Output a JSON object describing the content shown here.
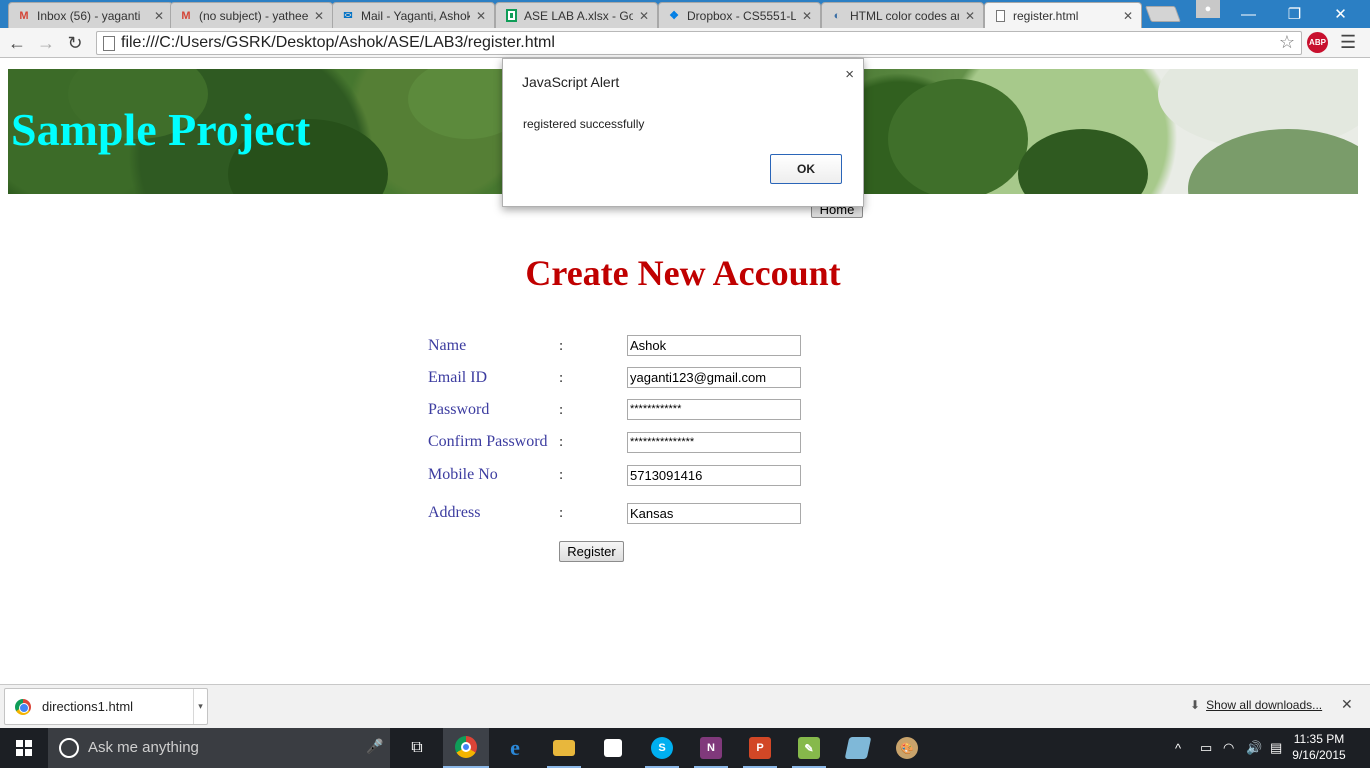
{
  "browser": {
    "tabs": [
      {
        "title": "Inbox (56) - yaganti",
        "icon": "gmail-icon",
        "icon_color": "#d44638"
      },
      {
        "title": "(no subject) - yathee",
        "icon": "gmail-icon",
        "icon_color": "#d44638"
      },
      {
        "title": "Mail - Yaganti, Ashok",
        "icon": "mail-icon",
        "icon_color": "#0072c6"
      },
      {
        "title": "ASE LAB A.xlsx - Goo",
        "icon": "sheets-icon",
        "icon_color": "#0f9d58"
      },
      {
        "title": "Dropbox - CS5551-L",
        "icon": "dropbox-icon",
        "icon_color": "#007ee5"
      },
      {
        "title": "HTML color codes an",
        "icon": "colorcodes-icon",
        "icon_color": "#3a6ea5"
      },
      {
        "title": "register.html",
        "icon": "page-icon",
        "icon_color": "#777777",
        "active": true
      }
    ],
    "url": "file:///C:/Users/GSRK/Desktop/Ashok/ASE/LAB3/register.html",
    "abp_label": "ABP"
  },
  "page": {
    "banner_title": "Sample Project",
    "home_button": "Home",
    "heading": "Create New Account",
    "colon": ":",
    "fields": [
      {
        "label": "Name",
        "value": "Ashok"
      },
      {
        "label": "Email ID",
        "value": "yaganti123@gmail.com"
      },
      {
        "label": "Password",
        "value": "************"
      },
      {
        "label": "Confirm Password",
        "value": "***************"
      },
      {
        "label": "Mobile No",
        "value": "5713091416"
      },
      {
        "label": "Address",
        "value": "Kansas"
      }
    ],
    "register_button": "Register",
    "colors": {
      "banner_title": "#00ffff",
      "heading": "#c00000",
      "labels": "#3c3ca0"
    }
  },
  "alert": {
    "title": "JavaScript Alert",
    "message": "registered successfully",
    "ok_label": "OK",
    "close_glyph": "×"
  },
  "downloads": {
    "item": "directions1.html",
    "show_all": "Show all downloads..."
  },
  "taskbar": {
    "search_placeholder": "Ask me anything",
    "time": "11:35 PM",
    "date": "9/16/2015"
  }
}
